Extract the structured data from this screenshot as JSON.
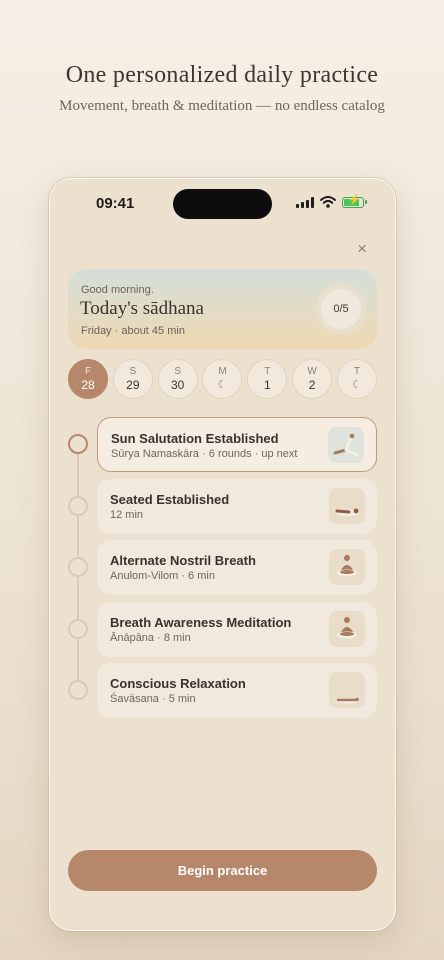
{
  "marketing": {
    "headline": "One personalized daily practice",
    "subline": "Movement, breath & meditation — no endless catalog"
  },
  "status_bar": {
    "time": "09:41",
    "icons": [
      "signal-icon",
      "wifi-icon",
      "battery-charging-icon"
    ]
  },
  "close_label": "×",
  "hero": {
    "greeting": "Good morning.",
    "title": "Today's sādhana",
    "meta": "Friday · about 45 min",
    "progress_label": "0/5",
    "progress_fraction": 0
  },
  "days": [
    {
      "letter": "F",
      "number": "28",
      "active": true
    },
    {
      "letter": "S",
      "number": "29"
    },
    {
      "letter": "S",
      "number": "30"
    },
    {
      "letter": "M",
      "icon": "moon-icon",
      "glyph": "☾"
    },
    {
      "letter": "T",
      "number": "1"
    },
    {
      "letter": "W",
      "number": "2"
    },
    {
      "letter": "T",
      "icon": "moon-icon",
      "glyph": "☾"
    }
  ],
  "practices": [
    {
      "title": "Sun Salutation Established",
      "subtitle": "Sūrya Namaskāra · 6 rounds · up next",
      "current": true,
      "icon": "sun-salutation-pose-icon"
    },
    {
      "title": "Seated Established",
      "subtitle": "12 min",
      "icon": "seated-pose-icon"
    },
    {
      "title": "Alternate Nostril Breath",
      "subtitle": "Anulom-Vilom · 6 min",
      "icon": "meditation-figure-icon"
    },
    {
      "title": "Breath Awareness Meditation",
      "subtitle": "Ānāpāna · 8 min",
      "icon": "meditation-figure-icon"
    },
    {
      "title": "Conscious Relaxation",
      "subtitle": "Śavāsana · 5 min",
      "icon": "lying-pose-icon"
    }
  ],
  "cta": {
    "label": "Begin practice"
  },
  "colors": {
    "accent": "#b6876a",
    "background": "#ece0cf",
    "card": "#f1e9dd"
  }
}
